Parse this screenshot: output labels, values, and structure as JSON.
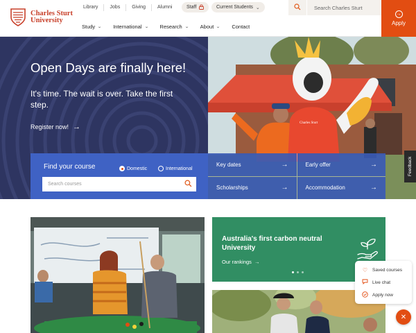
{
  "brand": {
    "line1": "Charles Sturt",
    "line2": "University",
    "color": "#c8402a"
  },
  "utility_links": [
    "Library",
    "Jobs",
    "Giving",
    "Alumni"
  ],
  "staff_pill": {
    "label": "Staff",
    "icon": "lock-icon"
  },
  "current_students_pill": {
    "label": "Current Students",
    "icon": "chevron-down-icon"
  },
  "search": {
    "placeholder": "Search Charles Sturt",
    "icon": "search-icon"
  },
  "apply": {
    "label": "Apply",
    "icon": "arrow-circle-icon",
    "color": "#e24d12"
  },
  "nav": [
    {
      "label": "Study",
      "has_menu": true
    },
    {
      "label": "International",
      "has_menu": true
    },
    {
      "label": "Research",
      "has_menu": true
    },
    {
      "label": "About",
      "has_menu": true
    },
    {
      "label": "Contact",
      "has_menu": false
    }
  ],
  "hero": {
    "title": "Open Days are finally here!",
    "subtitle": "It's time. The wait is over. Take the first step.",
    "cta": "Register now!",
    "bg_color": "#2e3561"
  },
  "find_course": {
    "title": "Find your course",
    "options": [
      {
        "label": "Domestic",
        "selected": true
      },
      {
        "label": "International",
        "selected": false
      }
    ],
    "placeholder": "Search courses"
  },
  "quick_links": [
    "Key dates",
    "Early offer",
    "Scholarships",
    "Accommodation"
  ],
  "feedback": "Feedback",
  "promo": {
    "title": "Australia's first carbon neutral University",
    "link": "Our rankings",
    "icon": "hand-plant-icon",
    "slides": 3,
    "active_slide": 1,
    "color": "#318e63"
  },
  "floating_menu": [
    {
      "label": "Saved courses",
      "icon": "heart-icon"
    },
    {
      "label": "Live chat",
      "icon": "chat-icon"
    },
    {
      "label": "Apply now",
      "icon": "check-circle-icon"
    }
  ],
  "close_icon": "close-icon"
}
